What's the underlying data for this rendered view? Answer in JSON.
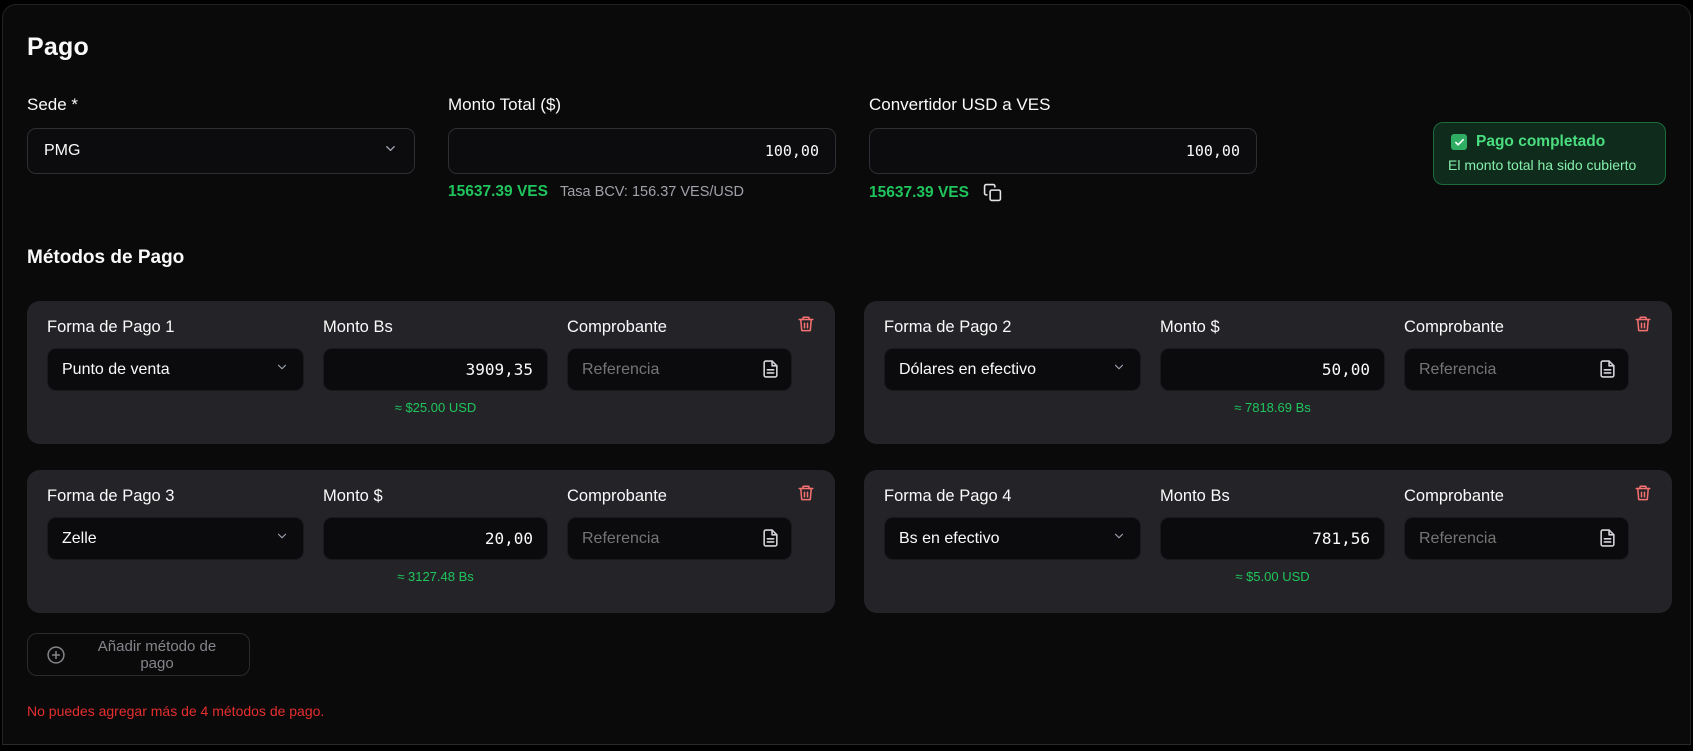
{
  "page": {
    "title": "Pago"
  },
  "fields": {
    "sede": {
      "label": "Sede *",
      "value": "PMG"
    },
    "monto_total": {
      "label": "Monto Total ($)",
      "value": "100,00",
      "ves": "15637.39 VES",
      "tasa": "Tasa BCV: 156.37 VES/USD"
    },
    "convertidor": {
      "label": "Convertidor USD a VES",
      "value": "100,00",
      "ves": "15637.39 VES",
      "copy_icon": "copy-icon"
    }
  },
  "status_badge": {
    "title": "Pago completado",
    "subtitle": "El monto total ha sido cubierto",
    "checkbox_icon": "checkbox-checked-icon"
  },
  "methods": {
    "heading": "Métodos de Pago",
    "cards": [
      {
        "label": "Forma de Pago 1",
        "method": "Punto de venta",
        "amount_label": "Monto Bs",
        "amount": "3909,35",
        "hint": "≈ $25.00 USD",
        "comprobante_label": "Comprobante",
        "placeholder": "Referencia"
      },
      {
        "label": "Forma de Pago 2",
        "method": "Dólares en efectivo",
        "amount_label": "Monto $",
        "amount": "50,00",
        "hint": "≈ 7818.69 Bs",
        "comprobante_label": "Comprobante",
        "placeholder": "Referencia"
      },
      {
        "label": "Forma de Pago 3",
        "method": "Zelle",
        "amount_label": "Monto $",
        "amount": "20,00",
        "hint": "≈ 3127.48 Bs",
        "comprobante_label": "Comprobante",
        "placeholder": "Referencia"
      },
      {
        "label": "Forma de Pago 4",
        "method": "Bs en efectivo",
        "amount_label": "Monto Bs",
        "amount": "781,56",
        "hint": "≈ $5.00 USD",
        "comprobante_label": "Comprobante",
        "placeholder": "Referencia"
      }
    ]
  },
  "footer": {
    "add_button": "Añadir método de pago",
    "warning": "No puedes agregar más de 4 métodos de pago."
  },
  "colors": {
    "accent_green": "#1fc55c",
    "badge_title_green": "#4ade80",
    "badge_subtitle_green": "#86efac",
    "badge_bg": "#0e2b1b",
    "badge_border": "#1c6b3d",
    "danger_red": "#e62e2e",
    "trash_red": "#f87171",
    "card_bg": "#242428",
    "input_bg": "#0c0c0e",
    "page_bg": "#0a0a0b",
    "muted_gray": "#a1a1aa"
  }
}
